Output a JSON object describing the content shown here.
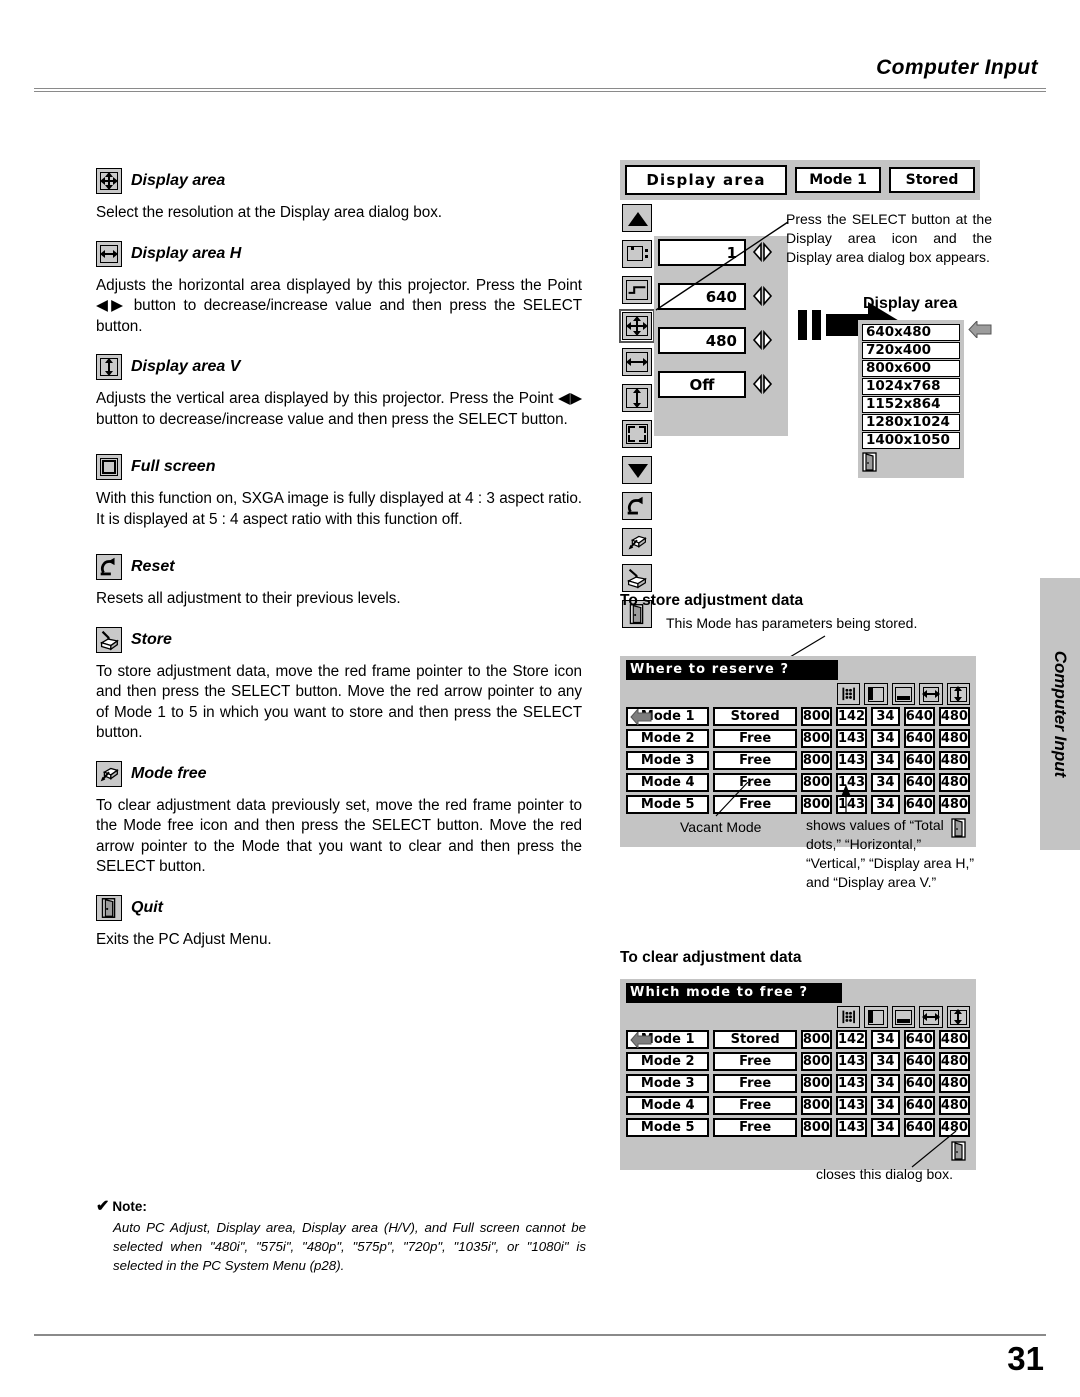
{
  "header": {
    "title": "Computer Input"
  },
  "footer": {
    "page_number": "31"
  },
  "side_tab": {
    "label": "Computer Input"
  },
  "left_column": {
    "sections": [
      {
        "icon": "display-area-icon",
        "title": "Display area",
        "body": "Select the resolution at the Display area dialog box."
      },
      {
        "icon": "display-area-h-icon",
        "title": "Display area H",
        "body": "Adjusts the horizontal area displayed by this projector.  Press the Point ◀▶ button to decrease/increase value and then press the SELECT button."
      },
      {
        "icon": "display-area-v-icon",
        "title": "Display area V",
        "body": "Adjusts the vertical area displayed by this projector.  Press the Point ◀▶ button to decrease/increase value and then press the SELECT button."
      },
      {
        "icon": "full-screen-icon",
        "title": "Full screen",
        "body": "With this function on, SXGA image is fully displayed at 4 : 3 aspect ratio.  It is displayed at 5 : 4 aspect ratio with this function off."
      },
      {
        "icon": "reset-icon",
        "title": "Reset",
        "body": "Resets all adjustment to their previous levels."
      },
      {
        "icon": "store-icon",
        "title": "Store",
        "body": "To store adjustment data, move the red frame pointer to the Store icon and then press the SELECT button.  Move the red arrow pointer to any of Mode 1 to 5 in which you want to store and then press the SELECT button."
      },
      {
        "icon": "mode-free-icon",
        "title": "Mode free",
        "body": "To clear adjustment data previously set, move the red frame pointer to the Mode free icon and then press the SELECT button.  Move the red arrow pointer to the Mode that you want to clear and then press the SELECT button."
      },
      {
        "icon": "quit-icon",
        "title": "Quit",
        "body": "Exits the PC Adjust Menu."
      }
    ]
  },
  "note": {
    "check_glyph": "✔",
    "heading": "Note:",
    "body": "Auto PC Adjust, Display area, Display area (H/V), and Full screen cannot be selected when \"480i\", \"575i\", \"480p\", \"575p\", \"720p\", \"1035i\", or \"1080i\" is selected in the PC System Menu (p28)."
  },
  "osd_menu": {
    "title": "Display area",
    "mode_label": "Mode 1",
    "stored_label": "Stored",
    "rail_icons": [
      "scroll-up-icon",
      "auto-pc-adjust-icon",
      "fine-sync-icon",
      "display-area-icon",
      "display-area-h-icon",
      "display-area-v-icon",
      "full-screen-icon",
      "scroll-down-icon",
      "reset-icon",
      "mode-free-icon",
      "store-icon",
      "quit-icon"
    ],
    "selected_rail_icon": "display-area-icon",
    "values": [
      {
        "icon": "fine-sync-icon",
        "value": "1"
      },
      {
        "icon": "display-area-h-icon",
        "value": "640"
      },
      {
        "icon": "display-area-v-icon",
        "value": "480"
      },
      {
        "icon": "full-screen-icon",
        "value": "Off"
      }
    ],
    "callout": "Press the SELECT button at the Display area icon and the Display area dialog box appears."
  },
  "display_area_dialog": {
    "title": "Display area",
    "options": [
      "640x480",
      "720x400",
      "800x600",
      "1024x768",
      "1152x864",
      "1280x1024",
      "1400x1050"
    ],
    "selected": "640x480",
    "quit_icon": "quit-icon"
  },
  "store_section": {
    "heading": "To store adjustment data",
    "callout_top": "This Mode has parameters being stored.",
    "callout_left": "Vacant Mode",
    "callout_right": "shows values of “Total dots,” “Horizontal,” “Vertical,” “Display area H,” and “Display area V.”",
    "dialog": {
      "prompt": "Where to reserve ?",
      "column_icons": [
        "total-dots-icon",
        "horizontal-icon",
        "vertical-icon",
        "display-area-h-icon",
        "display-area-v-icon"
      ],
      "rows": [
        {
          "mode": "Mode 1",
          "state": "Stored",
          "total_dots": "800",
          "horizontal": "142",
          "vertical": "34",
          "display_area_h": "640",
          "display_area_v": "480",
          "pointer": true
        },
        {
          "mode": "Mode 2",
          "state": "Free",
          "total_dots": "800",
          "horizontal": "143",
          "vertical": "34",
          "display_area_h": "640",
          "display_area_v": "480",
          "pointer": false
        },
        {
          "mode": "Mode 3",
          "state": "Free",
          "total_dots": "800",
          "horizontal": "143",
          "vertical": "34",
          "display_area_h": "640",
          "display_area_v": "480",
          "pointer": false
        },
        {
          "mode": "Mode 4",
          "state": "Free",
          "total_dots": "800",
          "horizontal": "143",
          "vertical": "34",
          "display_area_h": "640",
          "display_area_v": "480",
          "pointer": false
        },
        {
          "mode": "Mode 5",
          "state": "Free",
          "total_dots": "800",
          "horizontal": "143",
          "vertical": "34",
          "display_area_h": "640",
          "display_area_v": "480",
          "pointer": false
        }
      ],
      "quit_icon": "quit-icon"
    }
  },
  "clear_section": {
    "heading": "To clear adjustment data",
    "callout_bottom": "closes this dialog box.",
    "dialog": {
      "prompt": "Which mode to free ?",
      "column_icons": [
        "total-dots-icon",
        "horizontal-icon",
        "vertical-icon",
        "display-area-h-icon",
        "display-area-v-icon"
      ],
      "rows": [
        {
          "mode": "Mode 1",
          "state": "Stored",
          "total_dots": "800",
          "horizontal": "142",
          "vertical": "34",
          "display_area_h": "640",
          "display_area_v": "480",
          "pointer": true
        },
        {
          "mode": "Mode 2",
          "state": "Free",
          "total_dots": "800",
          "horizontal": "143",
          "vertical": "34",
          "display_area_h": "640",
          "display_area_v": "480",
          "pointer": false
        },
        {
          "mode": "Mode 3",
          "state": "Free",
          "total_dots": "800",
          "horizontal": "143",
          "vertical": "34",
          "display_area_h": "640",
          "display_area_v": "480",
          "pointer": false
        },
        {
          "mode": "Mode 4",
          "state": "Free",
          "total_dots": "800",
          "horizontal": "143",
          "vertical": "34",
          "display_area_h": "640",
          "display_area_v": "480",
          "pointer": false
        },
        {
          "mode": "Mode 5",
          "state": "Free",
          "total_dots": "800",
          "horizontal": "143",
          "vertical": "34",
          "display_area_h": "640",
          "display_area_v": "480",
          "pointer": false
        }
      ],
      "quit_icon": "quit-icon"
    }
  }
}
